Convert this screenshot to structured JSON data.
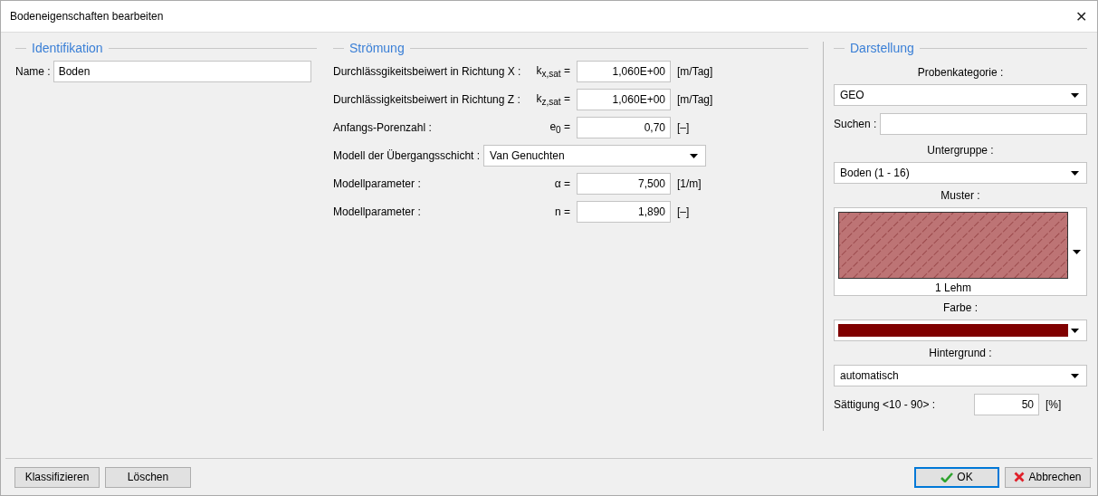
{
  "window": {
    "title": "Bodeneigenschaften bearbeiten",
    "close": "✕"
  },
  "identifikation": {
    "title": "Identifikation",
    "name_label": "Name :",
    "name_value": "Boden"
  },
  "stroemung": {
    "title": "Strömung",
    "rows": [
      {
        "kind": "input",
        "label": "Durchlässgikeitsbeiwert in Richtung X :",
        "symbol": "k$_{x,sat}$ =",
        "value": "1,060E+00",
        "unit": "[m/Tag]"
      },
      {
        "kind": "input",
        "label": "Durchlässigkeitsbeiwert in Richtung Z :",
        "symbol": "k$_{z,sat}$ =",
        "value": "1,060E+00",
        "unit": "[m/Tag]"
      },
      {
        "kind": "input",
        "label": "Anfangs-Porenzahl :",
        "symbol": "e$_{0}$ =",
        "value": "0,70",
        "unit": "[–]"
      },
      {
        "kind": "select",
        "label": "Modell der Übergangsschicht :",
        "value": "Van Genuchten"
      },
      {
        "kind": "input",
        "label": "Modellparameter :",
        "symbol": "α =",
        "value": "7,500",
        "unit": "[1/m]"
      },
      {
        "kind": "input",
        "label": "Modellparameter :",
        "symbol": "n =",
        "value": "1,890",
        "unit": "[–]"
      }
    ]
  },
  "darstellung": {
    "title": "Darstellung",
    "items": [
      {
        "kind": "heading",
        "text": "Probenkategorie :"
      },
      {
        "kind": "select",
        "value": "GEO"
      },
      {
        "kind": "search",
        "label": "Suchen :"
      },
      {
        "kind": "heading",
        "text": "Untergruppe :"
      },
      {
        "kind": "select",
        "value": "Boden (1 - 16)"
      },
      {
        "kind": "heading",
        "text": "Muster :"
      },
      {
        "kind": "pattern",
        "caption": "1 Lehm"
      },
      {
        "kind": "heading",
        "text": "Farbe :"
      },
      {
        "kind": "color",
        "color": "#800000"
      },
      {
        "kind": "heading",
        "text": "Hintergrund :"
      },
      {
        "kind": "select",
        "value": "automatisch"
      },
      {
        "kind": "number",
        "label": "Sättigung <10 - 90> :",
        "value": "50",
        "unit": "[%]"
      }
    ]
  },
  "footer": {
    "left_buttons": [
      "Klassifizieren",
      "Löschen"
    ],
    "ok": "OK",
    "cancel": "Abbrechen"
  }
}
